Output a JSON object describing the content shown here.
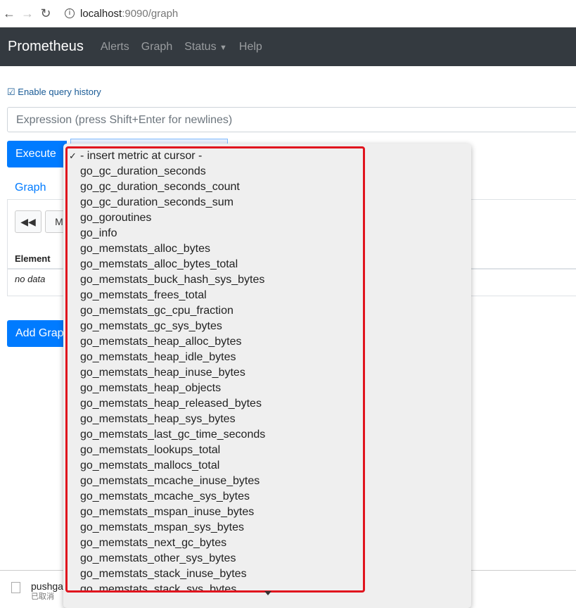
{
  "browser": {
    "url_host": "localhost",
    "url_rest": ":9090/graph"
  },
  "navbar": {
    "brand": "Prometheus",
    "links": [
      "Alerts",
      "Graph",
      "Status",
      "Help"
    ]
  },
  "query_history": "Enable query history",
  "expression_placeholder": "Expression (press Shift+Enter for newlines)",
  "execute": "Execute",
  "tab_graph": "Graph",
  "more_button": "M",
  "table": {
    "header": "Element",
    "empty": "no data"
  },
  "add_graph": "Add Graph",
  "download": {
    "name": "pushga",
    "status": "已取消"
  },
  "dropdown": {
    "selected": "- insert metric at cursor -",
    "items": [
      "go_gc_duration_seconds",
      "go_gc_duration_seconds_count",
      "go_gc_duration_seconds_sum",
      "go_goroutines",
      "go_info",
      "go_memstats_alloc_bytes",
      "go_memstats_alloc_bytes_total",
      "go_memstats_buck_hash_sys_bytes",
      "go_memstats_frees_total",
      "go_memstats_gc_cpu_fraction",
      "go_memstats_gc_sys_bytes",
      "go_memstats_heap_alloc_bytes",
      "go_memstats_heap_idle_bytes",
      "go_memstats_heap_inuse_bytes",
      "go_memstats_heap_objects",
      "go_memstats_heap_released_bytes",
      "go_memstats_heap_sys_bytes",
      "go_memstats_last_gc_time_seconds",
      "go_memstats_lookups_total",
      "go_memstats_mallocs_total",
      "go_memstats_mcache_inuse_bytes",
      "go_memstats_mcache_sys_bytes",
      "go_memstats_mspan_inuse_bytes",
      "go_memstats_mspan_sys_bytes",
      "go_memstats_next_gc_bytes",
      "go_memstats_other_sys_bytes",
      "go_memstats_stack_inuse_bytes",
      "go_memstats_stack_sys_bytes"
    ]
  }
}
